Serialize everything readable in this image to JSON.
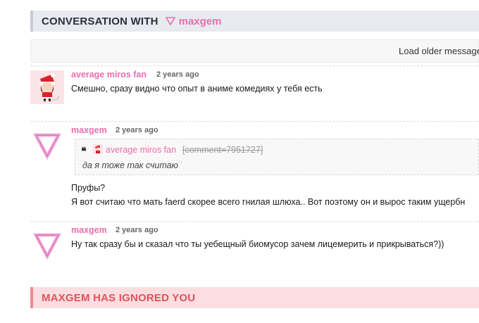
{
  "header": {
    "title": "CONVERSATION WITH",
    "username": "maxgem"
  },
  "load_older": {
    "label": "Load older message"
  },
  "comments": [
    {
      "author": "average miros fan",
      "time": "2 years ago",
      "avatar": "santa-avatar",
      "text": "Смешно, сразу видно что опыт в аниме комедиях у тебя есть"
    },
    {
      "author": "maxgem",
      "time": "2 years ago",
      "avatar": "pink-triangle-avatar",
      "quote": {
        "author": "average miros fan",
        "ref": "[comment=7951727]",
        "text": "да я тоже так считаю"
      },
      "lines": [
        "Пруфы?",
        "Я вот считаю что мать faerd скорее всего гнилая шлюха.. Вот поэтому он и вырос таким ущербн"
      ]
    },
    {
      "author": "maxgem",
      "time": "2 years ago",
      "avatar": "pink-triangle-avatar",
      "text": "Ну так сразу бы и сказал что ты уебещный биомусор зачем лицемерить и прикрываться?))"
    }
  ],
  "ignored_banner": {
    "label": "MAXGEM HAS IGNORED YOU"
  },
  "colors": {
    "accent": "#ea6eae",
    "header_bg": "#e8eaf0",
    "ignored_bg": "#fcdde0",
    "ignored_text": "#e0525f"
  }
}
